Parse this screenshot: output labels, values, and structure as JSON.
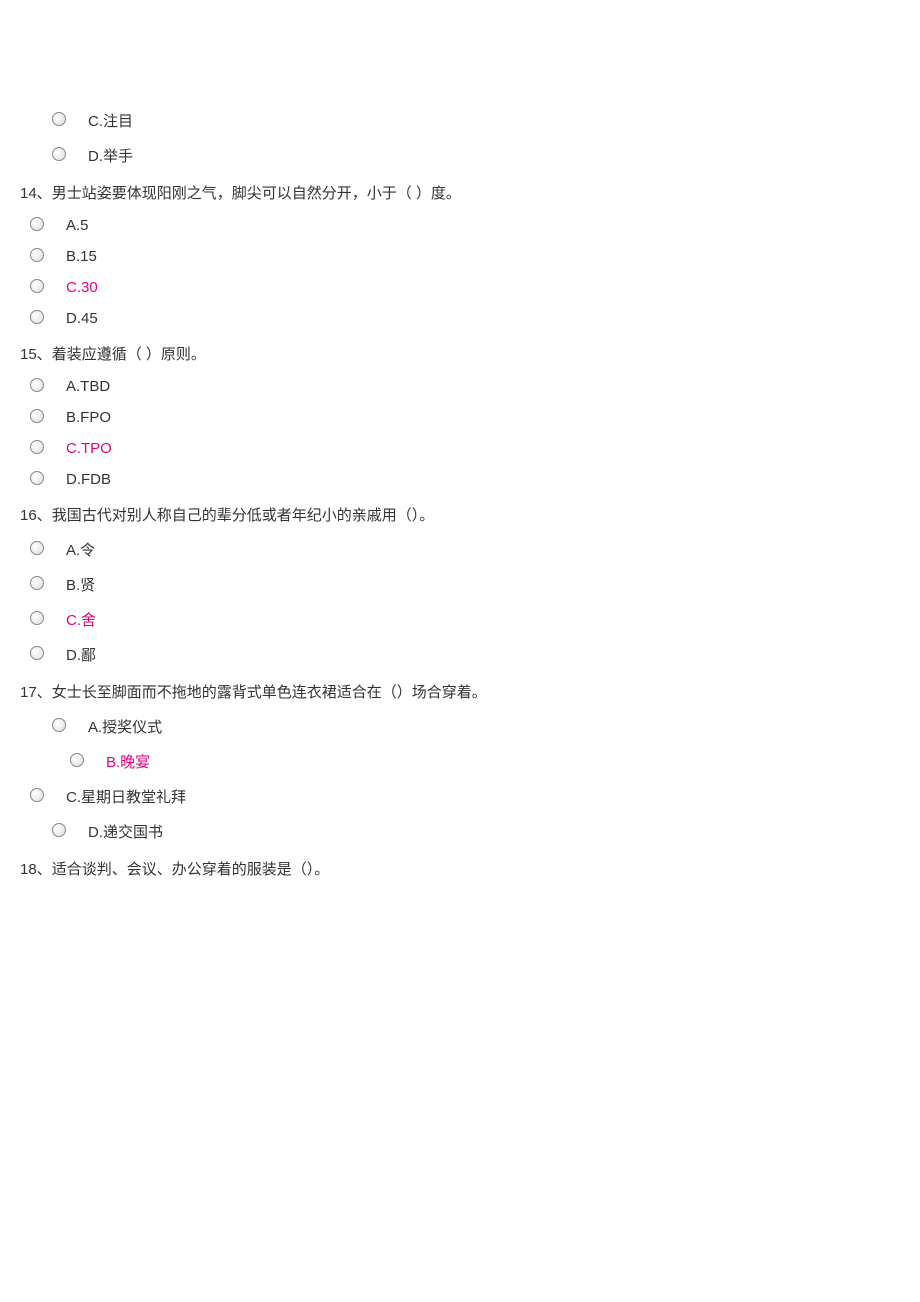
{
  "orphan_options": [
    {
      "label": "C.注目",
      "answer": false,
      "indent": "indent-2"
    },
    {
      "label": "D.举手",
      "answer": false,
      "indent": "indent-2"
    }
  ],
  "questions": [
    {
      "number": "14、",
      "stem": "男士站姿要体现阳刚之气，脚尖可以自然分开，小于（   ）度。",
      "options": [
        {
          "label": "A.5",
          "answer": false,
          "indent": "indent-1"
        },
        {
          "label": "B.15",
          "answer": false,
          "indent": "indent-1"
        },
        {
          "label": "C.30",
          "answer": true,
          "indent": "indent-1"
        },
        {
          "label": "D.45",
          "answer": false,
          "indent": "indent-1"
        }
      ]
    },
    {
      "number": "15、",
      "stem": "着装应遵循（  ）原则。",
      "options": [
        {
          "label": "A.TBD",
          "answer": false,
          "indent": "indent-1"
        },
        {
          "label": "B.FPO",
          "answer": false,
          "indent": "indent-1"
        },
        {
          "label": "C.TPO",
          "answer": true,
          "indent": "indent-1"
        },
        {
          "label": "D.FDB",
          "answer": false,
          "indent": "indent-1"
        }
      ]
    },
    {
      "number": "16、",
      "stem": "我国古代对别人称自己的辈分低或者年纪小的亲戚用（）。",
      "options": [
        {
          "label": "A.令",
          "answer": false,
          "indent": "indent-1"
        },
        {
          "label": "B.贤",
          "answer": false,
          "indent": "indent-1"
        },
        {
          "label": "C.舍",
          "answer": true,
          "indent": "indent-1"
        },
        {
          "label": "D.鄙",
          "answer": false,
          "indent": "indent-1"
        }
      ]
    },
    {
      "number": "17、",
      "stem": "女士长至脚面而不拖地的露背式单色连衣裙适合在（）场合穿着。",
      "options": [
        {
          "label": "A.授奖仪式",
          "answer": false,
          "indent": "indent-2"
        },
        {
          "label": "B.晚宴",
          "answer": true,
          "indent": "indent-3"
        },
        {
          "label": "C.星期日教堂礼拜",
          "answer": false,
          "indent": "indent-1"
        },
        {
          "label": "D.递交国书",
          "answer": false,
          "indent": "indent-2"
        }
      ]
    },
    {
      "number": "18、",
      "stem": "适合谈判、会议、办公穿着的服装是（）。",
      "options": []
    }
  ]
}
